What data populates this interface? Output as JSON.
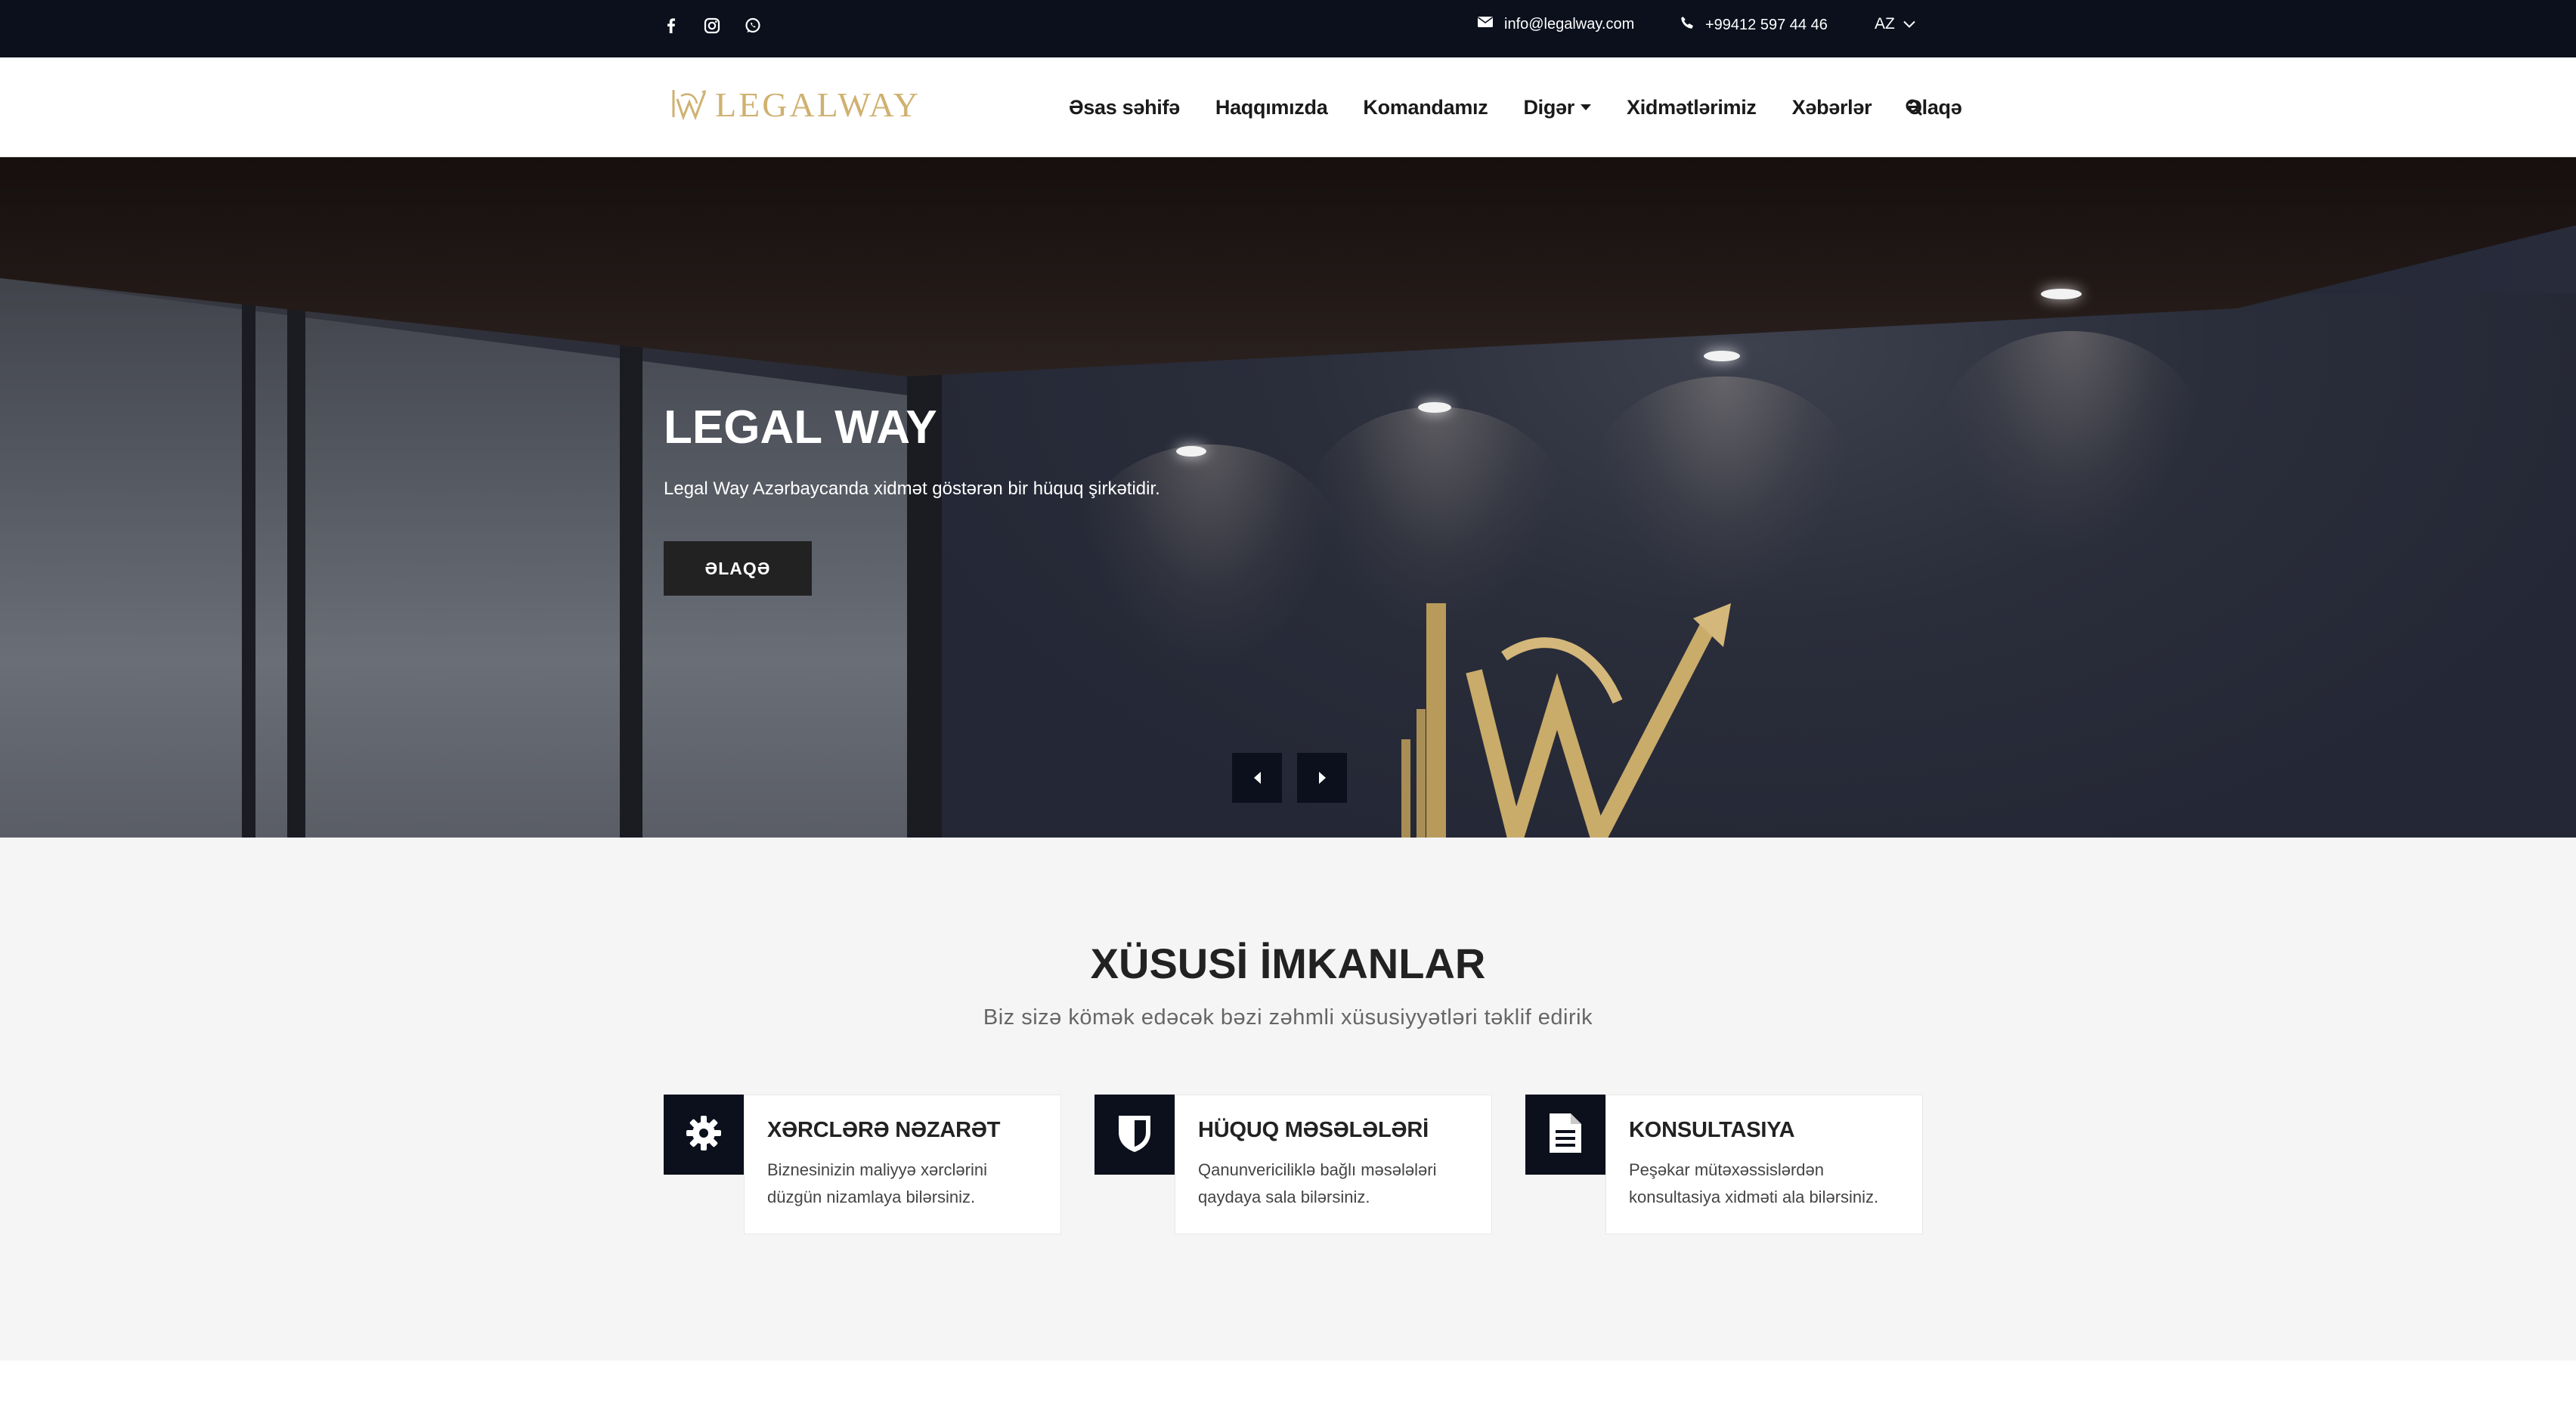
{
  "topbar": {
    "social_icons": [
      "facebook-icon",
      "instagram-icon",
      "whatsapp-icon"
    ],
    "email": "info@legalway.com",
    "phone": "+99412 597 44 46",
    "language": "AZ"
  },
  "header": {
    "logo_text": "LEGALWAY",
    "nav": {
      "home": "Əsas səhifə",
      "about": "Haqqımızda",
      "team": "Komandamız",
      "other": "Digər",
      "services": "Xidmətlərimiz",
      "news": "Xəbərlər",
      "contact": "Əlaqə"
    }
  },
  "hero": {
    "title": "LEGAL WAY",
    "subtitle": "Legal Way Azərbaycanda xidmət göstərən bir hüquq şirkətidir.",
    "button": "ƏLAQƏ"
  },
  "features": {
    "title": "XÜSUSİ İMKANLAR",
    "subtitle": "Biz sizə kömək edəcək bəzi zəhmli xüsusiyyətləri təklif edirik",
    "cards": [
      {
        "icon": "gear-icon",
        "title": "XƏRCLƏRƏ NƏZARƏT",
        "text": "Biznesinizin maliyyə xərclərini düzgün nizamlaya bilərsiniz."
      },
      {
        "icon": "shield-icon",
        "title": "HÜQUQ MƏSƏLƏLƏRİ",
        "text": "Qanunvericiliklə bağlı məsələləri qaydaya sala bilərsiniz."
      },
      {
        "icon": "document-icon",
        "title": "KONSULTASIYA",
        "text": "Peşəkar mütəxəssislərdən konsultasiya xidməti ala bilərsiniz."
      }
    ]
  },
  "colors": {
    "dark": "#0b101c",
    "gold": "#cfb170",
    "section_bg": "#f5f5f5"
  }
}
